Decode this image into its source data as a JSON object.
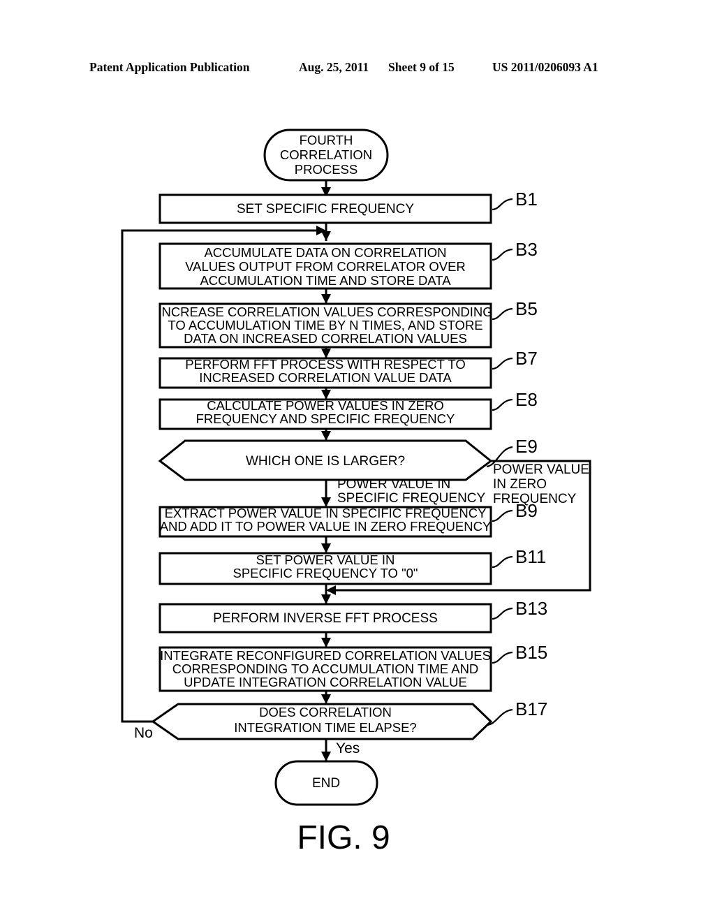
{
  "header": {
    "publication": "Patent Application Publication",
    "date": "Aug. 25, 2011",
    "sheet": "Sheet 9 of 15",
    "patent_number": "US 2011/0206093 A1"
  },
  "figure": {
    "caption": "FIG. 9",
    "title": "FOURTH CORRELATION PROCESS"
  },
  "nodes": {
    "start": {
      "ref": "",
      "lines": [
        "FOURTH",
        "CORRELATION",
        "PROCESS"
      ]
    },
    "b1": {
      "ref": "B1",
      "lines": [
        "SET SPECIFIC FREQUENCY"
      ]
    },
    "b3": {
      "ref": "B3",
      "lines": [
        "ACCUMULATE DATA ON CORRELATION",
        "VALUES OUTPUT FROM CORRELATOR OVER",
        "ACCUMULATION TIME AND STORE DATA"
      ]
    },
    "b5": {
      "ref": "B5",
      "lines": [
        "INCREASE CORRELATION VALUES CORRESPONDING",
        "TO ACCUMULATION TIME BY N TIMES, AND STORE",
        "DATA ON INCREASED CORRELATION VALUES"
      ]
    },
    "b7": {
      "ref": "B7",
      "lines": [
        "PERFORM FFT PROCESS WITH RESPECT TO",
        "INCREASED CORRELATION VALUE DATA"
      ]
    },
    "e8": {
      "ref": "E8",
      "lines": [
        "CALCULATE POWER VALUES IN ZERO",
        "FREQUENCY AND SPECIFIC FREQUENCY"
      ]
    },
    "e9": {
      "ref": "E9",
      "lines": [
        "WHICH ONE IS LARGER?"
      ]
    },
    "b9": {
      "ref": "B9",
      "lines": [
        "EXTRACT POWER VALUE IN SPECIFIC FREQUENCY",
        "AND ADD IT TO POWER VALUE IN ZERO FREQUENCY"
      ]
    },
    "b11": {
      "ref": "B11",
      "lines": [
        "SET POWER VALUE IN",
        "SPECIFIC FREQUENCY TO \"0\""
      ]
    },
    "b13": {
      "ref": "B13",
      "lines": [
        "PERFORM INVERSE FFT PROCESS"
      ]
    },
    "b15": {
      "ref": "B15",
      "lines": [
        "INTEGRATE RECONFIGURED CORRELATION VALUES",
        "CORRESPONDING TO ACCUMULATION TIME AND",
        "UPDATE INTEGRATION CORRELATION VALUE"
      ]
    },
    "b17": {
      "ref": "B17",
      "lines": [
        "DOES CORRELATION",
        "INTEGRATION TIME ELAPSE?"
      ]
    },
    "end": {
      "ref": "",
      "lines": [
        "END"
      ]
    }
  },
  "branches": {
    "e9_down_line1": "POWER VALUE IN",
    "e9_down_line2": "SPECIFIC FREQUENCY",
    "e9_right_line1": "POWER VALUE",
    "e9_right_line2": "IN ZERO",
    "e9_right_line3": "FREQUENCY",
    "b17_no": "No",
    "b17_yes": "Yes"
  },
  "colors": {
    "stroke": "#000000",
    "fill": "#ffffff",
    "background": "#ffffff"
  }
}
